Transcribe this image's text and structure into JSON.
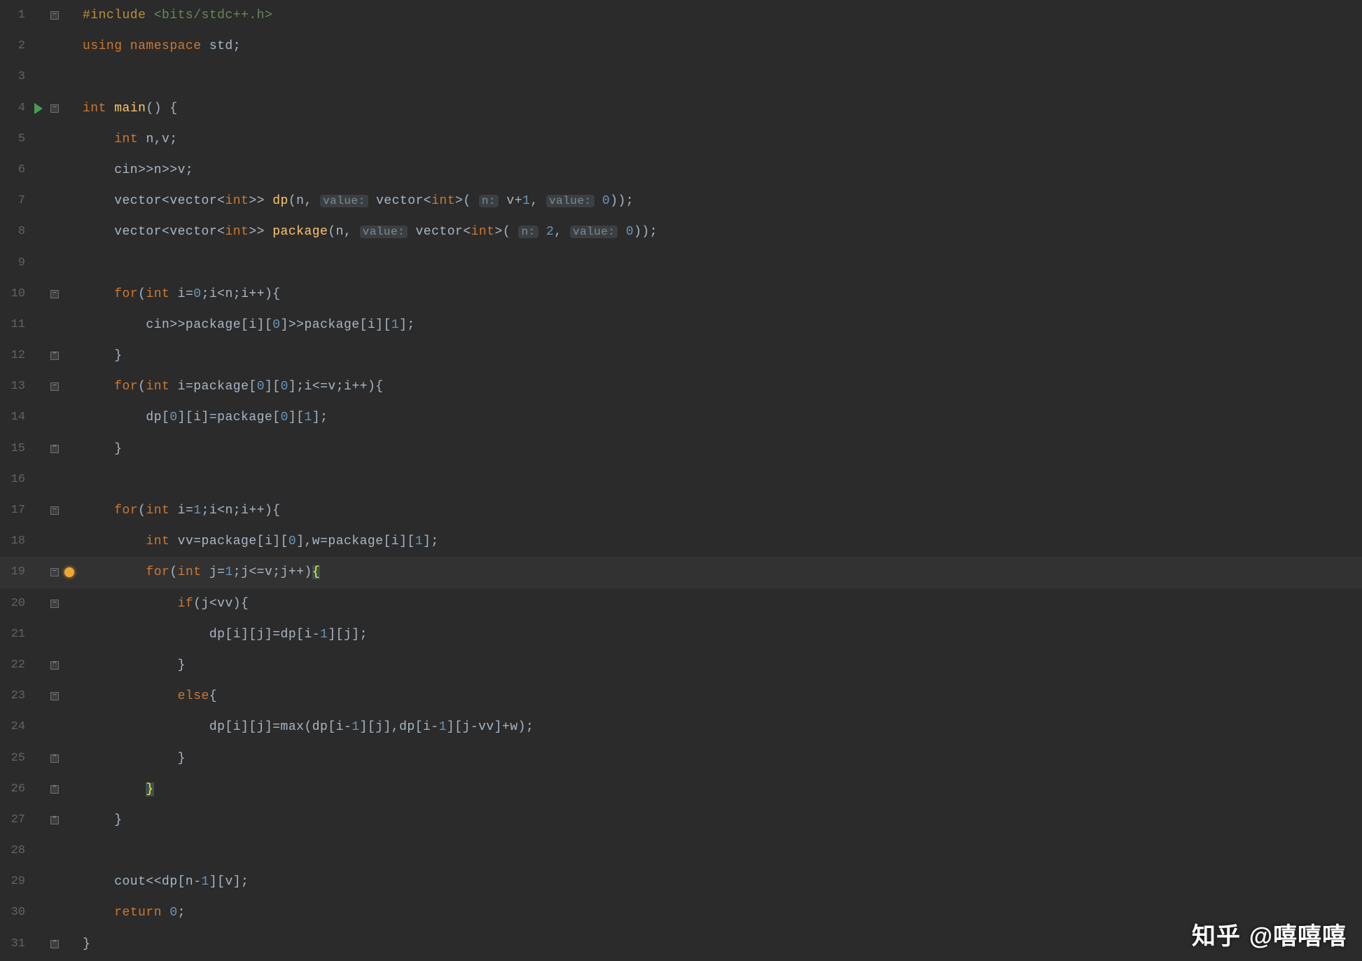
{
  "colors": {
    "background": "#2b2b2b",
    "gutter_text": "#606366",
    "keyword": "#cc7832",
    "number": "#6897bb",
    "function": "#ffc66d",
    "string_header": "#6a8759",
    "hint_bg": "#3b3f41",
    "plain": "#a9b7c6",
    "current_line": "#323232",
    "brace_match": "#3b514d"
  },
  "current_line": 19,
  "watermark": {
    "logo": "知乎",
    "handle": "@嘻嘻嘻"
  },
  "lines": [
    {
      "n": 1,
      "run": false,
      "fold": "open",
      "bulb": false,
      "tokens": [
        {
          "cls": "c-pre",
          "t": "#include "
        },
        {
          "cls": "c-hdr",
          "t": "<bits/stdc++.h>"
        }
      ]
    },
    {
      "n": 2,
      "run": false,
      "fold": "",
      "bulb": false,
      "tokens": [
        {
          "cls": "c-keyword",
          "t": "using namespace "
        },
        {
          "cls": "c-plain",
          "t": "std;"
        }
      ]
    },
    {
      "n": 3,
      "run": false,
      "fold": "",
      "bulb": false,
      "tokens": []
    },
    {
      "n": 4,
      "run": true,
      "fold": "open",
      "bulb": false,
      "tokens": [
        {
          "cls": "c-keyword",
          "t": "int "
        },
        {
          "cls": "c-func",
          "t": "main"
        },
        {
          "cls": "c-plain",
          "t": "() {"
        }
      ]
    },
    {
      "n": 5,
      "run": false,
      "fold": "",
      "bulb": false,
      "tokens": [
        {
          "cls": "c-plain",
          "t": "    "
        },
        {
          "cls": "c-keyword",
          "t": "int "
        },
        {
          "cls": "c-plain",
          "t": "n,v;"
        }
      ]
    },
    {
      "n": 6,
      "run": false,
      "fold": "",
      "bulb": false,
      "tokens": [
        {
          "cls": "c-plain",
          "t": "    cin>>n>>v;"
        }
      ]
    },
    {
      "n": 7,
      "run": false,
      "fold": "",
      "bulb": false,
      "tokens": [
        {
          "cls": "c-plain",
          "t": "    vector<vector<"
        },
        {
          "cls": "c-keyword",
          "t": "int"
        },
        {
          "cls": "c-plain",
          "t": ">> "
        },
        {
          "cls": "c-func",
          "t": "dp"
        },
        {
          "cls": "c-plain",
          "t": "(n, "
        },
        {
          "cls": "c-hint-bg",
          "t": "value:"
        },
        {
          "cls": "c-plain",
          "t": " vector<"
        },
        {
          "cls": "c-keyword",
          "t": "int"
        },
        {
          "cls": "c-plain",
          "t": ">( "
        },
        {
          "cls": "c-hint-bg",
          "t": "n:"
        },
        {
          "cls": "c-plain",
          "t": " v+"
        },
        {
          "cls": "c-num",
          "t": "1"
        },
        {
          "cls": "c-plain",
          "t": ", "
        },
        {
          "cls": "c-hint-bg",
          "t": "value:"
        },
        {
          "cls": "c-plain",
          "t": " "
        },
        {
          "cls": "c-num",
          "t": "0"
        },
        {
          "cls": "c-plain",
          "t": "));"
        }
      ]
    },
    {
      "n": 8,
      "run": false,
      "fold": "",
      "bulb": false,
      "tokens": [
        {
          "cls": "c-plain",
          "t": "    vector<vector<"
        },
        {
          "cls": "c-keyword",
          "t": "int"
        },
        {
          "cls": "c-plain",
          "t": ">> "
        },
        {
          "cls": "c-func",
          "t": "package"
        },
        {
          "cls": "c-plain",
          "t": "(n, "
        },
        {
          "cls": "c-hint-bg",
          "t": "value:"
        },
        {
          "cls": "c-plain",
          "t": " vector<"
        },
        {
          "cls": "c-keyword",
          "t": "int"
        },
        {
          "cls": "c-plain",
          "t": ">( "
        },
        {
          "cls": "c-hint-bg",
          "t": "n:"
        },
        {
          "cls": "c-plain",
          "t": " "
        },
        {
          "cls": "c-num",
          "t": "2"
        },
        {
          "cls": "c-plain",
          "t": ", "
        },
        {
          "cls": "c-hint-bg",
          "t": "value:"
        },
        {
          "cls": "c-plain",
          "t": " "
        },
        {
          "cls": "c-num",
          "t": "0"
        },
        {
          "cls": "c-plain",
          "t": "));"
        }
      ]
    },
    {
      "n": 9,
      "run": false,
      "fold": "",
      "bulb": false,
      "tokens": []
    },
    {
      "n": 10,
      "run": false,
      "fold": "open",
      "bulb": false,
      "tokens": [
        {
          "cls": "c-plain",
          "t": "    "
        },
        {
          "cls": "c-keyword",
          "t": "for"
        },
        {
          "cls": "c-plain",
          "t": "("
        },
        {
          "cls": "c-keyword",
          "t": "int "
        },
        {
          "cls": "c-plain",
          "t": "i="
        },
        {
          "cls": "c-num",
          "t": "0"
        },
        {
          "cls": "c-plain",
          "t": ";i<n;i++){"
        }
      ]
    },
    {
      "n": 11,
      "run": false,
      "fold": "",
      "bulb": false,
      "tokens": [
        {
          "cls": "c-plain",
          "t": "        cin>>package[i]["
        },
        {
          "cls": "c-num",
          "t": "0"
        },
        {
          "cls": "c-plain",
          "t": "]>>package[i]["
        },
        {
          "cls": "c-num",
          "t": "1"
        },
        {
          "cls": "c-plain",
          "t": "];"
        }
      ]
    },
    {
      "n": 12,
      "run": false,
      "fold": "close",
      "bulb": false,
      "tokens": [
        {
          "cls": "c-plain",
          "t": "    }"
        }
      ]
    },
    {
      "n": 13,
      "run": false,
      "fold": "open",
      "bulb": false,
      "tokens": [
        {
          "cls": "c-plain",
          "t": "    "
        },
        {
          "cls": "c-keyword",
          "t": "for"
        },
        {
          "cls": "c-plain",
          "t": "("
        },
        {
          "cls": "c-keyword",
          "t": "int "
        },
        {
          "cls": "c-plain",
          "t": "i=package["
        },
        {
          "cls": "c-num",
          "t": "0"
        },
        {
          "cls": "c-plain",
          "t": "]["
        },
        {
          "cls": "c-num",
          "t": "0"
        },
        {
          "cls": "c-plain",
          "t": "];i<=v;i++){"
        }
      ]
    },
    {
      "n": 14,
      "run": false,
      "fold": "",
      "bulb": false,
      "tokens": [
        {
          "cls": "c-plain",
          "t": "        dp["
        },
        {
          "cls": "c-num",
          "t": "0"
        },
        {
          "cls": "c-plain",
          "t": "][i]=package["
        },
        {
          "cls": "c-num",
          "t": "0"
        },
        {
          "cls": "c-plain",
          "t": "]["
        },
        {
          "cls": "c-num",
          "t": "1"
        },
        {
          "cls": "c-plain",
          "t": "];"
        }
      ]
    },
    {
      "n": 15,
      "run": false,
      "fold": "close",
      "bulb": false,
      "tokens": [
        {
          "cls": "c-plain",
          "t": "    }"
        }
      ]
    },
    {
      "n": 16,
      "run": false,
      "fold": "",
      "bulb": false,
      "tokens": []
    },
    {
      "n": 17,
      "run": false,
      "fold": "open",
      "bulb": false,
      "tokens": [
        {
          "cls": "c-plain",
          "t": "    "
        },
        {
          "cls": "c-keyword",
          "t": "for"
        },
        {
          "cls": "c-plain",
          "t": "("
        },
        {
          "cls": "c-keyword",
          "t": "int "
        },
        {
          "cls": "c-plain",
          "t": "i="
        },
        {
          "cls": "c-num",
          "t": "1"
        },
        {
          "cls": "c-plain",
          "t": ";i<n;i++){"
        }
      ]
    },
    {
      "n": 18,
      "run": false,
      "fold": "",
      "bulb": false,
      "tokens": [
        {
          "cls": "c-plain",
          "t": "        "
        },
        {
          "cls": "c-keyword",
          "t": "int "
        },
        {
          "cls": "c-plain",
          "t": "vv=package[i]["
        },
        {
          "cls": "c-num",
          "t": "0"
        },
        {
          "cls": "c-plain",
          "t": "],w=package[i]["
        },
        {
          "cls": "c-num",
          "t": "1"
        },
        {
          "cls": "c-plain",
          "t": "];"
        }
      ]
    },
    {
      "n": 19,
      "run": false,
      "fold": "open",
      "bulb": true,
      "tokens": [
        {
          "cls": "c-plain",
          "t": "        "
        },
        {
          "cls": "c-keyword",
          "t": "for"
        },
        {
          "cls": "c-plain",
          "t": "("
        },
        {
          "cls": "c-keyword",
          "t": "int "
        },
        {
          "cls": "c-plain",
          "t": "j="
        },
        {
          "cls": "c-num",
          "t": "1"
        },
        {
          "cls": "c-plain",
          "t": ";j<=v;j++)"
        },
        {
          "cls": "c-brace-hl",
          "t": "{"
        }
      ]
    },
    {
      "n": 20,
      "run": false,
      "fold": "open",
      "bulb": false,
      "tokens": [
        {
          "cls": "c-plain",
          "t": "            "
        },
        {
          "cls": "c-keyword",
          "t": "if"
        },
        {
          "cls": "c-plain",
          "t": "(j<vv){"
        }
      ]
    },
    {
      "n": 21,
      "run": false,
      "fold": "",
      "bulb": false,
      "tokens": [
        {
          "cls": "c-plain",
          "t": "                dp[i][j]=dp[i-"
        },
        {
          "cls": "c-num",
          "t": "1"
        },
        {
          "cls": "c-plain",
          "t": "][j];"
        }
      ]
    },
    {
      "n": 22,
      "run": false,
      "fold": "close",
      "bulb": false,
      "tokens": [
        {
          "cls": "c-plain",
          "t": "            }"
        }
      ]
    },
    {
      "n": 23,
      "run": false,
      "fold": "open",
      "bulb": false,
      "tokens": [
        {
          "cls": "c-plain",
          "t": "            "
        },
        {
          "cls": "c-keyword",
          "t": "else"
        },
        {
          "cls": "c-plain",
          "t": "{"
        }
      ]
    },
    {
      "n": 24,
      "run": false,
      "fold": "",
      "bulb": false,
      "tokens": [
        {
          "cls": "c-plain",
          "t": "                dp[i][j]=max(dp[i-"
        },
        {
          "cls": "c-num",
          "t": "1"
        },
        {
          "cls": "c-plain",
          "t": "][j],dp[i-"
        },
        {
          "cls": "c-num",
          "t": "1"
        },
        {
          "cls": "c-plain",
          "t": "][j-vv]+w);"
        }
      ]
    },
    {
      "n": 25,
      "run": false,
      "fold": "close",
      "bulb": false,
      "tokens": [
        {
          "cls": "c-plain",
          "t": "            }"
        }
      ]
    },
    {
      "n": 26,
      "run": false,
      "fold": "close",
      "bulb": false,
      "tokens": [
        {
          "cls": "c-plain",
          "t": "        "
        },
        {
          "cls": "c-brace-hl",
          "t": "}"
        }
      ]
    },
    {
      "n": 27,
      "run": false,
      "fold": "close",
      "bulb": false,
      "tokens": [
        {
          "cls": "c-plain",
          "t": "    }"
        }
      ]
    },
    {
      "n": 28,
      "run": false,
      "fold": "",
      "bulb": false,
      "tokens": []
    },
    {
      "n": 29,
      "run": false,
      "fold": "",
      "bulb": false,
      "tokens": [
        {
          "cls": "c-plain",
          "t": "    cout<<dp[n-"
        },
        {
          "cls": "c-num",
          "t": "1"
        },
        {
          "cls": "c-plain",
          "t": "][v];"
        }
      ]
    },
    {
      "n": 30,
      "run": false,
      "fold": "",
      "bulb": false,
      "tokens": [
        {
          "cls": "c-plain",
          "t": "    "
        },
        {
          "cls": "c-keyword",
          "t": "return "
        },
        {
          "cls": "c-num",
          "t": "0"
        },
        {
          "cls": "c-plain",
          "t": ";"
        }
      ]
    },
    {
      "n": 31,
      "run": false,
      "fold": "close",
      "bulb": false,
      "tokens": [
        {
          "cls": "c-plain",
          "t": "}"
        }
      ]
    }
  ]
}
